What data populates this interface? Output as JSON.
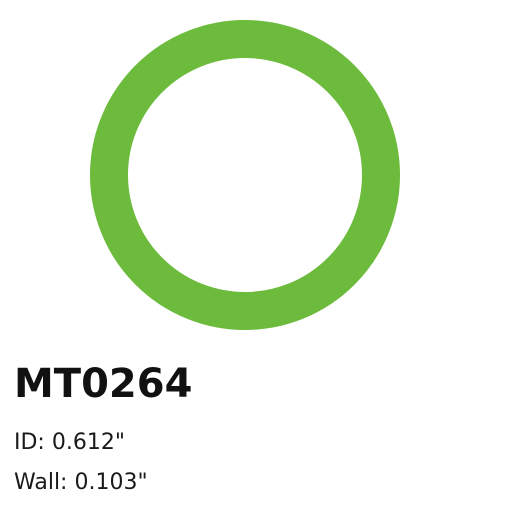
{
  "product": {
    "part_number": "MT0264",
    "id_text": "ID: 0.612\"",
    "wall_text": "Wall: 0.103\"",
    "ring_color": "#6cbb3c",
    "ring_image": "o-ring"
  }
}
